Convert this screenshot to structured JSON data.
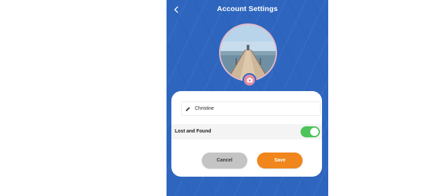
{
  "header": {
    "title": "Account Settings",
    "back_icon": "chevron-left-icon"
  },
  "profile": {
    "avatar_alt": "",
    "camera_icon": "camera-icon"
  },
  "form": {
    "name_value": "Christine",
    "edit_icon": "pencil-icon",
    "toggle_label": "Lost and Found",
    "toggle_on": true
  },
  "actions": {
    "cancel_label": "Cancel",
    "save_label": "Save"
  },
  "colors": {
    "background": "#2e66bf",
    "toggle_on": "#4cc45a",
    "save": "#f0861c",
    "cancel": "#c4c4c4",
    "camera_badge": "#e48ba4"
  }
}
